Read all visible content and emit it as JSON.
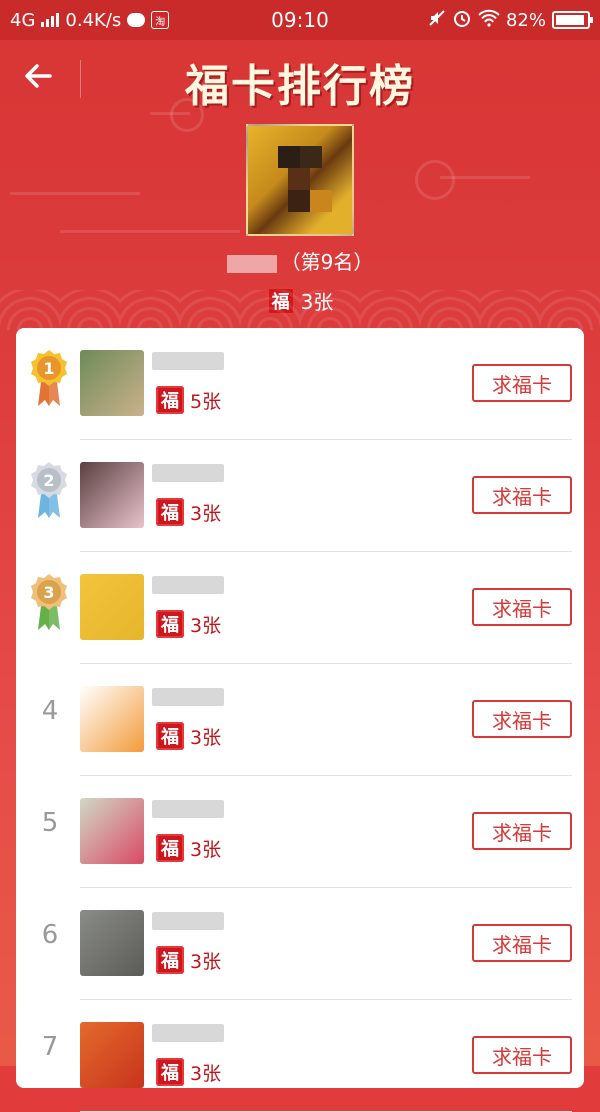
{
  "statusbar": {
    "network": "4G",
    "speed": "0.4K/s",
    "app_badge": "淘",
    "time": "09:10",
    "battery": "82%",
    "battery_level": 0.82
  },
  "header": {
    "title": "福卡排行榜"
  },
  "me": {
    "rank_text": "（第9名）",
    "card_icon": "福",
    "count": "3张"
  },
  "leaderboard": {
    "button_label": "求福卡",
    "rows": [
      {
        "rank": "1",
        "count": "5张",
        "medal": "gold",
        "avatar": [
          "#6e8a5a",
          "#cbb28a"
        ]
      },
      {
        "rank": "2",
        "count": "3张",
        "medal": "silver",
        "avatar": [
          "#5a4040",
          "#e9c2cc"
        ]
      },
      {
        "rank": "3",
        "count": "3张",
        "medal": "bronze",
        "avatar": [
          "#f2c53d",
          "#e6b52b"
        ]
      },
      {
        "rank": "4",
        "count": "3张",
        "medal": "",
        "avatar": [
          "#ffffff",
          "#f39b3a"
        ]
      },
      {
        "rank": "5",
        "count": "3张",
        "medal": "",
        "avatar": [
          "#d0d9c6",
          "#d94a66"
        ]
      },
      {
        "rank": "6",
        "count": "3张",
        "medal": "",
        "avatar": [
          "#8a8c88",
          "#5b5b57"
        ]
      },
      {
        "rank": "7",
        "count": "3张",
        "medal": "",
        "avatar": [
          "#e46a2c",
          "#c6341c"
        ]
      }
    ]
  },
  "colors": {
    "primary_red": "#d33a3a",
    "gold": "#f0b429",
    "silver": "#c9cdd3",
    "bronze": "#e7ab57"
  }
}
